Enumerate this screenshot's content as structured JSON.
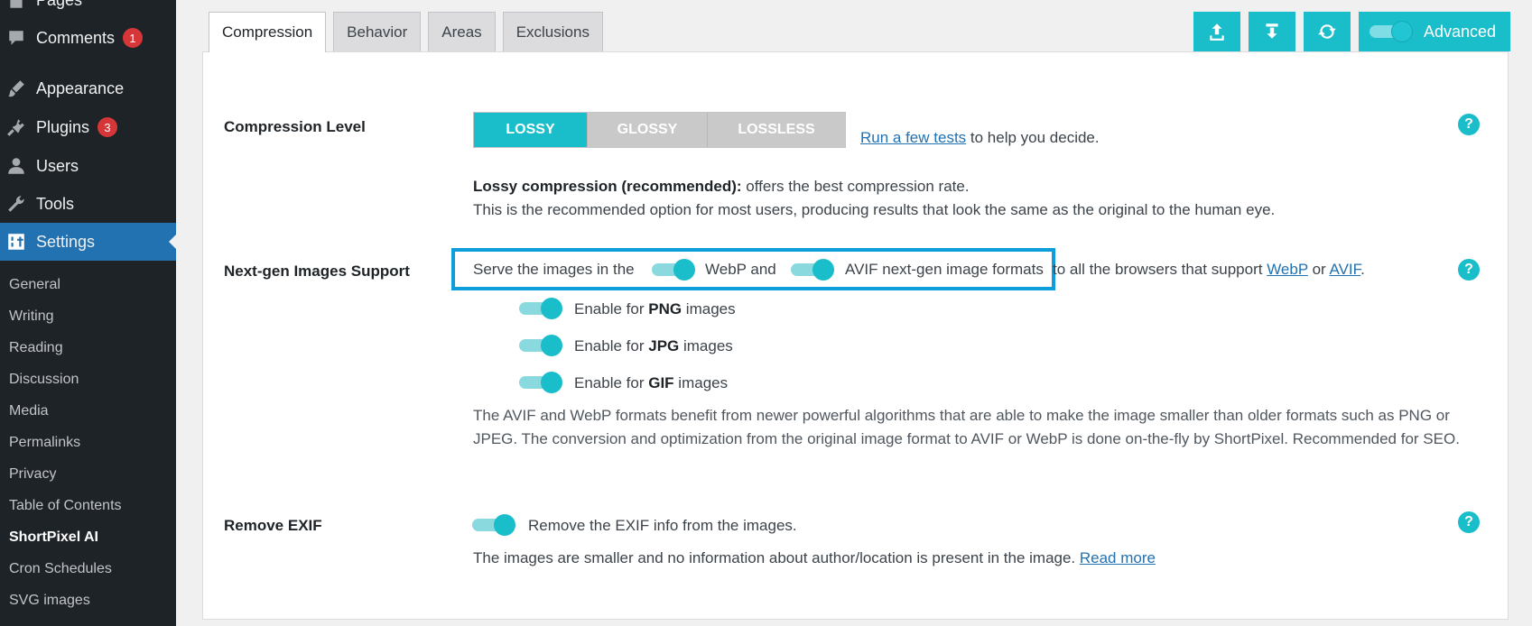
{
  "sidebar": {
    "items": [
      {
        "label": "Pages",
        "icon": "pages-icon"
      },
      {
        "label": "Comments",
        "icon": "comment-icon",
        "badge": "1"
      },
      {
        "label": "Appearance",
        "icon": "brush-icon"
      },
      {
        "label": "Plugins",
        "icon": "plug-icon",
        "badge": "3"
      },
      {
        "label": "Users",
        "icon": "user-icon"
      },
      {
        "label": "Tools",
        "icon": "wrench-icon"
      },
      {
        "label": "Settings",
        "icon": "settings-icon",
        "active": true
      }
    ],
    "submenu": [
      "General",
      "Writing",
      "Reading",
      "Discussion",
      "Media",
      "Permalinks",
      "Privacy",
      "Table of Contents",
      "ShortPixel AI",
      "Cron Schedules",
      "SVG images"
    ],
    "current_submenu": "ShortPixel AI"
  },
  "tabs": [
    {
      "label": "Compression",
      "active": true
    },
    {
      "label": "Behavior"
    },
    {
      "label": "Areas"
    },
    {
      "label": "Exclusions"
    }
  ],
  "toolbar": {
    "buttons": [
      "upload-icon",
      "download-icon",
      "refresh-icon"
    ],
    "advanced_label": "Advanced",
    "advanced_on": true
  },
  "compression": {
    "label": "Compression Level",
    "options": [
      "LOSSY",
      "GLOSSY",
      "LOSSLESS"
    ],
    "selected": "LOSSY",
    "tests_link": "Run a few tests",
    "tests_suffix": " to help you decide.",
    "desc_bold": "Lossy compression (recommended):",
    "desc_rest": " offers the best compression rate.",
    "desc_line2": "This is the recommended option for most users, producing results that look the same as the original to the human eye."
  },
  "nextgen": {
    "label": "Next-gen Images Support",
    "serve_prefix": "Serve the images in the",
    "webp_label": "WebP and",
    "avif_label": "AVIF next-gen image formats",
    "suffix": " to all the browsers that support ",
    "webp_link": "WebP",
    "or": " or ",
    "avif_link": "AVIF",
    "period": ".",
    "png_pre": "Enable for ",
    "png_bold": "PNG",
    "png_post": " images",
    "jpg_pre": "Enable for ",
    "jpg_bold": "JPG",
    "jpg_post": " images",
    "gif_pre": "Enable for ",
    "gif_bold": "GIF",
    "gif_post": " images",
    "description": "The AVIF and WebP formats benefit from newer powerful algorithms that are able to make the image smaller than older formats such as PNG or JPEG. The conversion and optimization from the original image format to AVIF or WebP is done on-the-fly by ShortPixel. Recommended for SEO."
  },
  "exif": {
    "label": "Remove EXIF",
    "toggle_text": "Remove the EXIF info from the images.",
    "desc": "The images are smaller and no information about author/location is present in the image. ",
    "read_more": "Read more"
  },
  "help_glyph": "?",
  "colors": {
    "accent": "#1abdca",
    "sidebar": "#1d2327",
    "active": "#2271b1",
    "highlight": "#0d9ddb"
  }
}
